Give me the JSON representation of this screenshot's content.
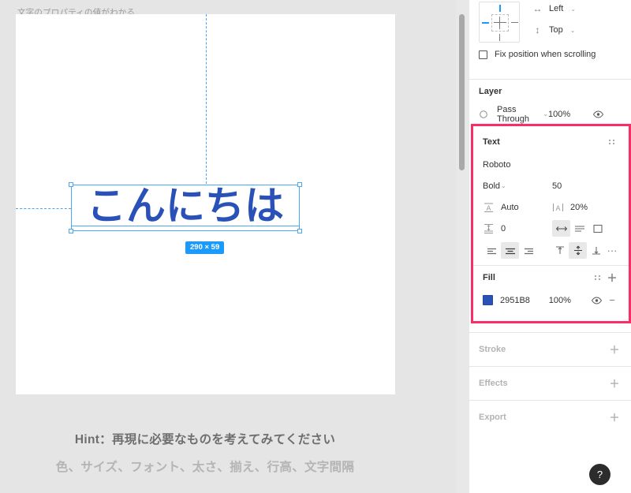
{
  "canvas": {
    "frame_label": "文字のプロパティの値がわかる",
    "text_layer_content": "こんにちは",
    "dimension_badge": "290 × 59",
    "selection_color": "#49a8f8",
    "text_color": "#2951B8"
  },
  "hint": {
    "line1": "Hint：再現に必要なものを考えてみてください",
    "line2": "色、サイズ、フォント、太さ、揃え、行高、文字間隔"
  },
  "panel": {
    "constraints": {
      "horizontal_icon": "horizontal-arrows-icon",
      "horizontal_value": "Left",
      "vertical_icon": "vertical-arrows-icon",
      "vertical_value": "Top",
      "fix_position_label": "Fix position when scrolling",
      "fix_position_checked": false
    },
    "layer": {
      "title": "Layer",
      "blend_mode": "Pass Through",
      "opacity": "100%"
    },
    "text": {
      "title": "Text",
      "font_family": "Roboto",
      "font_weight": "Bold",
      "font_size": "50",
      "line_height_icon": "line-height-icon",
      "line_height": "Auto",
      "letter_spacing_icon": "letter-spacing-icon",
      "letter_spacing": "20%",
      "paragraph_spacing_icon": "paragraph-spacing-icon",
      "paragraph_spacing": "0",
      "resize_options": [
        "auto-width",
        "auto-height",
        "fixed-size"
      ],
      "resize_selected": "auto-width",
      "horizontal_align_options": [
        "align-left",
        "align-center",
        "align-right"
      ],
      "horizontal_align_selected": "align-center",
      "vertical_align_options": [
        "align-top",
        "align-middle",
        "align-bottom"
      ],
      "vertical_align_selected": "align-middle",
      "more_label": "···"
    },
    "fill": {
      "title": "Fill",
      "hex": "2951B8",
      "swatch_color": "#2951B8",
      "opacity": "100%"
    },
    "stroke": {
      "title": "Stroke"
    },
    "effects": {
      "title": "Effects"
    },
    "export": {
      "title": "Export"
    },
    "highlight_color": "#FB2D68"
  },
  "help": {
    "label": "?"
  }
}
